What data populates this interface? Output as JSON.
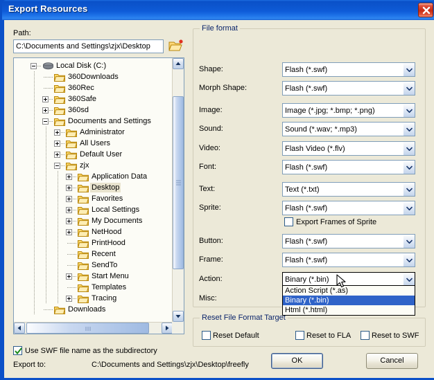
{
  "window": {
    "title": "Export Resources",
    "close_icon": "close-icon"
  },
  "path": {
    "label": "Path:",
    "value": "C:\\Documents and Settings\\zjx\\Desktop",
    "browse_icon": "browse-folder-icon"
  },
  "tree": {
    "nodes": [
      {
        "label": "Local Disk (C:)",
        "depth": 0,
        "toggle": "minus",
        "icon": "drive-icon",
        "selected": false
      },
      {
        "label": "360Downloads",
        "depth": 1,
        "toggle": "none",
        "icon": "folder-icon",
        "selected": false
      },
      {
        "label": "360Rec",
        "depth": 1,
        "toggle": "none",
        "icon": "folder-icon",
        "selected": false
      },
      {
        "label": "360Safe",
        "depth": 1,
        "toggle": "plus",
        "icon": "folder-icon",
        "selected": false
      },
      {
        "label": "360sd",
        "depth": 1,
        "toggle": "plus",
        "icon": "folder-icon",
        "selected": false
      },
      {
        "label": "Documents and Settings",
        "depth": 1,
        "toggle": "minus",
        "icon": "folder-icon",
        "selected": false
      },
      {
        "label": "Administrator",
        "depth": 2,
        "toggle": "plus",
        "icon": "folder-icon",
        "selected": false
      },
      {
        "label": "All Users",
        "depth": 2,
        "toggle": "plus",
        "icon": "folder-icon",
        "selected": false
      },
      {
        "label": "Default User",
        "depth": 2,
        "toggle": "plus",
        "icon": "folder-icon",
        "selected": false
      },
      {
        "label": "zjx",
        "depth": 2,
        "toggle": "minus",
        "icon": "folder-icon",
        "selected": false
      },
      {
        "label": "Application Data",
        "depth": 3,
        "toggle": "plus",
        "icon": "folder-icon",
        "selected": false
      },
      {
        "label": "Desktop",
        "depth": 3,
        "toggle": "plus",
        "icon": "folder-icon",
        "selected": true
      },
      {
        "label": "Favorites",
        "depth": 3,
        "toggle": "plus",
        "icon": "folder-icon",
        "selected": false
      },
      {
        "label": "Local Settings",
        "depth": 3,
        "toggle": "plus",
        "icon": "folder-icon",
        "selected": false
      },
      {
        "label": "My Documents",
        "depth": 3,
        "toggle": "plus",
        "icon": "folder-icon",
        "selected": false
      },
      {
        "label": "NetHood",
        "depth": 3,
        "toggle": "plus",
        "icon": "folder-icon",
        "selected": false
      },
      {
        "label": "PrintHood",
        "depth": 3,
        "toggle": "none",
        "icon": "folder-icon",
        "selected": false
      },
      {
        "label": "Recent",
        "depth": 3,
        "toggle": "none",
        "icon": "folder-icon",
        "selected": false
      },
      {
        "label": "SendTo",
        "depth": 3,
        "toggle": "none",
        "icon": "folder-icon",
        "selected": false
      },
      {
        "label": "Start Menu",
        "depth": 3,
        "toggle": "plus",
        "icon": "folder-icon",
        "selected": false
      },
      {
        "label": "Templates",
        "depth": 3,
        "toggle": "none",
        "icon": "folder-icon",
        "selected": false
      },
      {
        "label": "Tracing",
        "depth": 3,
        "toggle": "plus",
        "icon": "folder-icon",
        "selected": false
      },
      {
        "label": "Downloads",
        "depth": 1,
        "toggle": "none",
        "icon": "folder-icon",
        "selected": false
      }
    ]
  },
  "file_format": {
    "title": "File format",
    "rows": [
      {
        "label": "Shape:",
        "value": "Flash (*.swf)"
      },
      {
        "label": "Morph Shape:",
        "value": "Flash (*.swf)"
      },
      {
        "label": "Image:",
        "value": "Image (*.jpg; *.bmp; *.png)"
      },
      {
        "label": "Sound:",
        "value": "Sound (*.wav; *.mp3)"
      },
      {
        "label": "Video:",
        "value": "Flash Video (*.flv)"
      },
      {
        "label": "Font:",
        "value": "Flash (*.swf)"
      },
      {
        "label": "Text:",
        "value": "Text (*.txt)"
      },
      {
        "label": "Sprite:",
        "value": "Flash (*.swf)"
      },
      {
        "label": "Button:",
        "value": "Flash (*.swf)"
      },
      {
        "label": "Frame:",
        "value": "Flash (*.swf)"
      },
      {
        "label": "Action:",
        "value": "Binary (*.bin)"
      },
      {
        "label": "Misc:",
        "value": ""
      }
    ],
    "export_frames": {
      "label": "Export Frames of Sprite",
      "checked": false
    }
  },
  "action_dropdown": {
    "open": true,
    "options": [
      {
        "label": "Action Script (*.as)",
        "selected": false
      },
      {
        "label": "Binary (*.bin)",
        "selected": true
      },
      {
        "label": "Html (*.html)",
        "selected": false
      }
    ]
  },
  "reset_group": {
    "title": "Reset File Format Target",
    "checkboxes": [
      {
        "label": "Reset Default",
        "checked": false
      },
      {
        "label": "Reset to FLA",
        "checked": false
      },
      {
        "label": "Reset to SWF",
        "checked": false
      }
    ]
  },
  "bottom": {
    "use_swf_subdir": {
      "label": "Use SWF file name as the subdirectory",
      "checked": true
    },
    "export_to_label": "Export to:",
    "export_to_value": "C:\\Documents and Settings\\zjx\\Desktop\\freefly"
  },
  "buttons": {
    "ok": "OK",
    "cancel": "Cancel"
  },
  "colors": {
    "titlebar_blue": "#0A50C8",
    "client_beige": "#ECE9D8",
    "group_title_blue": "#0A246A",
    "selection_blue": "#2F63C8",
    "tree_selection": "#E8E3CE"
  }
}
